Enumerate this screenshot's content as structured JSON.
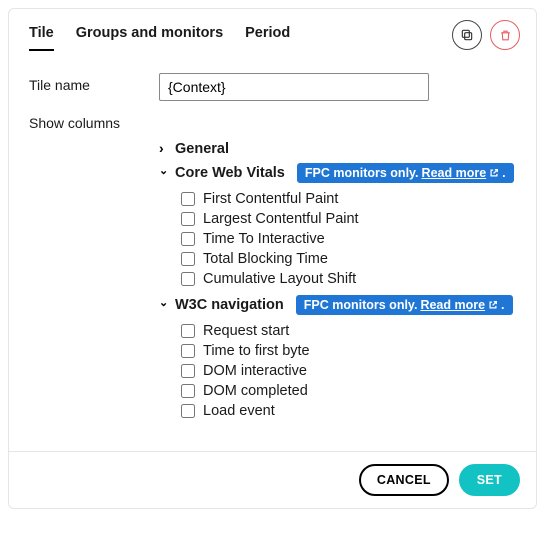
{
  "tabs": {
    "tile": "Tile",
    "groups": "Groups and monitors",
    "period": "Period"
  },
  "labels": {
    "tile_name": "Tile name",
    "show_columns": "Show columns"
  },
  "tile_name_value": "{Context}",
  "sections": {
    "general": {
      "title": "General"
    },
    "cwv": {
      "title": "Core Web Vitals",
      "badge_prefix": "FPC monitors only.",
      "badge_link": "Read more",
      "items": [
        "First Contentful Paint",
        "Largest Contentful Paint",
        "Time To Interactive",
        "Total Blocking Time",
        "Cumulative Layout Shift"
      ]
    },
    "w3c": {
      "title": "W3C navigation",
      "badge_prefix": "FPC monitors only.",
      "badge_link": "Read more",
      "items": [
        "Request start",
        "Time to first byte",
        "DOM interactive",
        "DOM completed",
        "Load event"
      ]
    }
  },
  "buttons": {
    "cancel": "CANCEL",
    "set": "SET"
  }
}
